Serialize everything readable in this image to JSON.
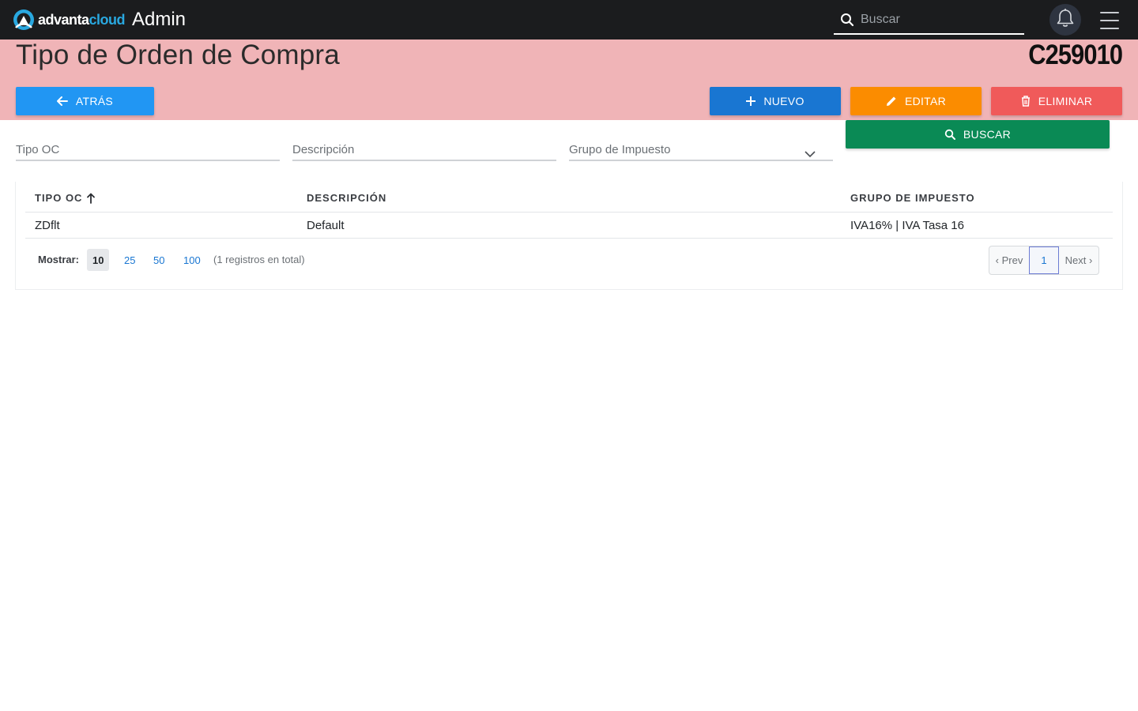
{
  "topbar": {
    "logo_left": "advanta",
    "logo_right": "cloud",
    "app_name": "Admin",
    "search_placeholder": "Buscar",
    "icons": [
      "search-icon",
      "bell-icon",
      "hamburger-icon"
    ]
  },
  "header": {
    "title": "Tipo de Orden de Compra",
    "company_code": "C259010",
    "back_label": "ATRÁS",
    "new_label": "NUEVO",
    "edit_label": "EDITAR",
    "delete_label": "ELIMINAR",
    "band_color": "#f0b4b7"
  },
  "filters": {
    "tipo_oc": "Tipo OC",
    "descripcion": "Descripción",
    "grupo_impuesto": "Grupo de Impuesto",
    "search_label": "BUSCAR"
  },
  "table": {
    "columns": [
      "TIPO OC",
      "DESCRIPCIÓN",
      "GRUPO DE IMPUESTO"
    ],
    "sort": "ascending",
    "rows": [
      {
        "tipo_oc": "ZDflt",
        "descripcion": "Default",
        "grupo_impuesto": "IVA16% | IVA Tasa 16"
      }
    ]
  },
  "pagination": {
    "show_label": "Mostrar:",
    "sizes": [
      "10",
      "25",
      "50",
      "100"
    ],
    "selected_size": "10",
    "total": "(1 registros en total)",
    "prev": "‹ Prev",
    "current": "1",
    "next": "Next ›"
  },
  "colors": {
    "back": "#2196f3",
    "new": "#1976d2",
    "edit": "#fb8c00",
    "delete": "#f05a5a",
    "search": "#0a8a55",
    "topbar": "#1b1c1e"
  }
}
